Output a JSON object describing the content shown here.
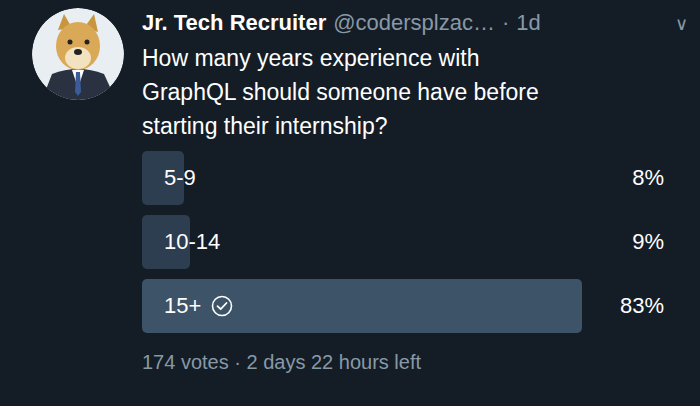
{
  "tweet": {
    "name": "Jr. Tech Recruiter",
    "handle": "@codersplzac…",
    "separator": "·",
    "time": "1d",
    "menu": "∨",
    "text": "How many years experience with GraphQL should someone have before starting their internship?"
  },
  "poll": {
    "options": [
      {
        "label": "5-9",
        "percent": "8%",
        "level": 0.08,
        "selected": false
      },
      {
        "label": "10-14",
        "percent": "9%",
        "level": 0.09,
        "selected": false
      },
      {
        "label": "15+",
        "percent": "83%",
        "level": 0.83,
        "selected": true
      }
    ],
    "footer": "174 votes · 2 days 22 hours left"
  }
}
